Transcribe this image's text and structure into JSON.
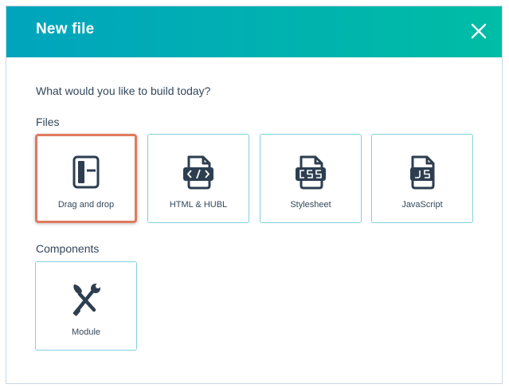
{
  "dialog": {
    "title": "New file",
    "prompt": "What would you like to build today?",
    "close_icon": "close-icon"
  },
  "files": {
    "label": "Files",
    "tiles": [
      {
        "label": "Drag and drop",
        "icon": "drag-and-drop-layout-icon",
        "selected": true
      },
      {
        "label": "HTML & HUBL",
        "icon": "html-file-icon",
        "selected": false
      },
      {
        "label": "Stylesheet",
        "icon": "css-file-icon",
        "selected": false
      },
      {
        "label": "JavaScript",
        "icon": "js-file-icon",
        "selected": false
      }
    ]
  },
  "components": {
    "label": "Components",
    "tiles": [
      {
        "label": "Module",
        "icon": "module-tools-icon",
        "selected": false
      }
    ]
  },
  "colors": {
    "header_gradient_start": "#00a4bd",
    "header_gradient_end": "#00bda5",
    "text": "#33475b",
    "tile_border": "#7fd1de",
    "selected_border": "#e07a5f",
    "icon": "#2d3e50"
  }
}
